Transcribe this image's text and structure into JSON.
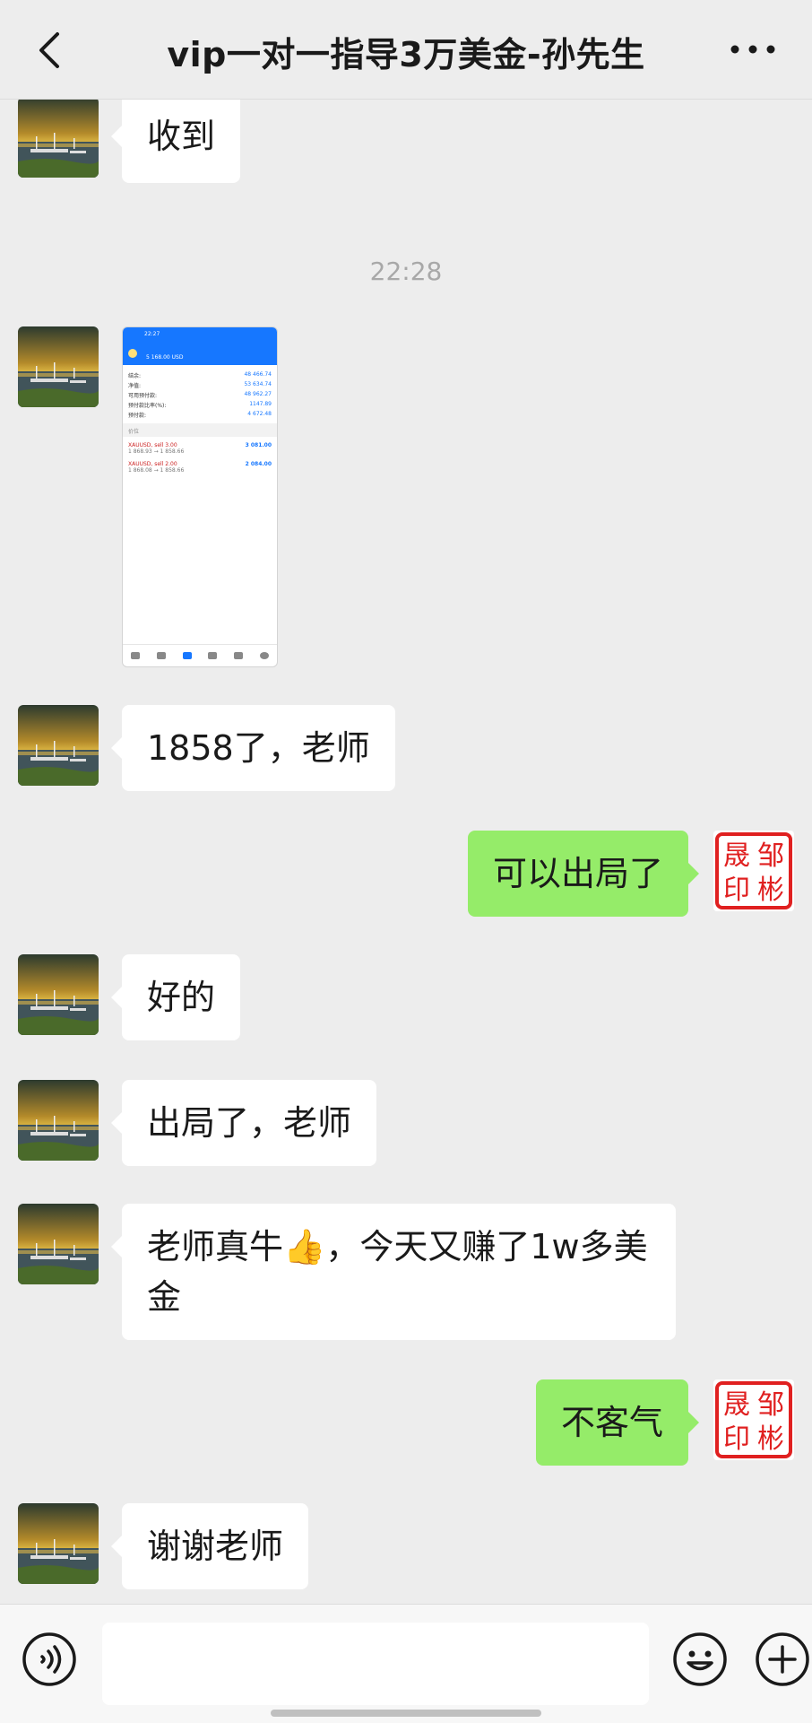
{
  "header": {
    "title": "vip一对一指导3万美金-孙先生",
    "back_icon": "chevron-left-icon",
    "more_icon": "more-dots-icon"
  },
  "seal": {
    "chars": [
      "邹",
      "彬",
      "晟",
      "印"
    ],
    "color": "#e02020"
  },
  "messages": [
    {
      "side": "left",
      "type": "text",
      "text": "收到"
    },
    {
      "type": "time",
      "text": "22:28"
    },
    {
      "side": "left",
      "type": "image",
      "screenshot": {
        "status_time": "22:27",
        "balance": "5 168.00 USD",
        "rows": [
          {
            "label": "结余:",
            "value": "48 466.74"
          },
          {
            "label": "净值:",
            "value": "53 634.74"
          },
          {
            "label": "可用预付款:",
            "value": "48 962.27"
          },
          {
            "label": "预付款比率(%):",
            "value": "1147.89"
          },
          {
            "label": "预付款:",
            "value": "4 672.48"
          }
        ],
        "section": "价位",
        "positions": [
          {
            "symbol": "XAUUSD, sell 3.00",
            "range": "1 868.93 → 1 858.66",
            "profit": "3 081.00"
          },
          {
            "symbol": "XAUUSD, sell 2.00",
            "range": "1 868.08 → 1 858.66",
            "profit": "2 084.00"
          }
        ]
      }
    },
    {
      "side": "left",
      "type": "text",
      "text": "1858了，老师"
    },
    {
      "side": "right",
      "type": "text",
      "text": "可以出局了"
    },
    {
      "side": "left",
      "type": "text",
      "text": "好的"
    },
    {
      "side": "left",
      "type": "text",
      "text": "出局了，老师"
    },
    {
      "side": "left",
      "type": "text",
      "text": "老师真牛👍，今天又赚了1w多美金"
    },
    {
      "side": "right",
      "type": "text",
      "text": "不客气"
    },
    {
      "side": "left",
      "type": "text",
      "text": "谢谢老师"
    }
  ],
  "input_bar": {
    "voice_icon": "voice-icon",
    "emoji_icon": "emoji-icon",
    "plus_icon": "plus-icon",
    "placeholder": ""
  }
}
